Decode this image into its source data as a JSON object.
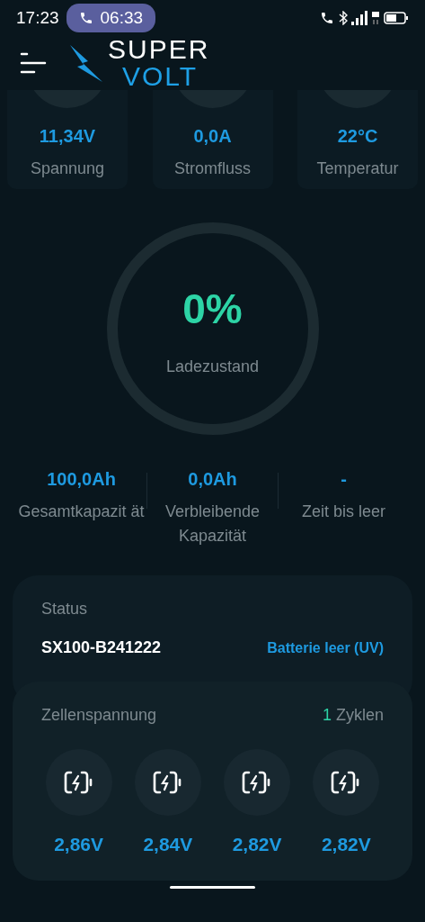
{
  "status_bar": {
    "time": "17:23",
    "call_timer": "06:33"
  },
  "header": {
    "logo_top": "SUPER",
    "logo_bottom": "VOLT"
  },
  "metrics": [
    {
      "value": "11,34V",
      "label": "Spannung"
    },
    {
      "value": "0,0A",
      "label": "Stromfluss"
    },
    {
      "value": "22°C",
      "label": "Temperatur"
    }
  ],
  "charge": {
    "value": "0%",
    "label": "Ladezustand"
  },
  "capacity": [
    {
      "value": "100,0Ah",
      "label": "Gesamtkapazit ät"
    },
    {
      "value": "0,0Ah",
      "label": "Verbleibende Kapazität"
    },
    {
      "value": "-",
      "label": "Zeit bis leer"
    }
  ],
  "status": {
    "title": "Status",
    "serial": "SX100-B241222",
    "state": "Batterie leer (UV)"
  },
  "cells": {
    "title": "Zellenspannung",
    "cycles_count": "1",
    "cycles_label": "Zyklen",
    "voltages": [
      "2,86V",
      "2,84V",
      "2,82V",
      "2,82V"
    ]
  }
}
